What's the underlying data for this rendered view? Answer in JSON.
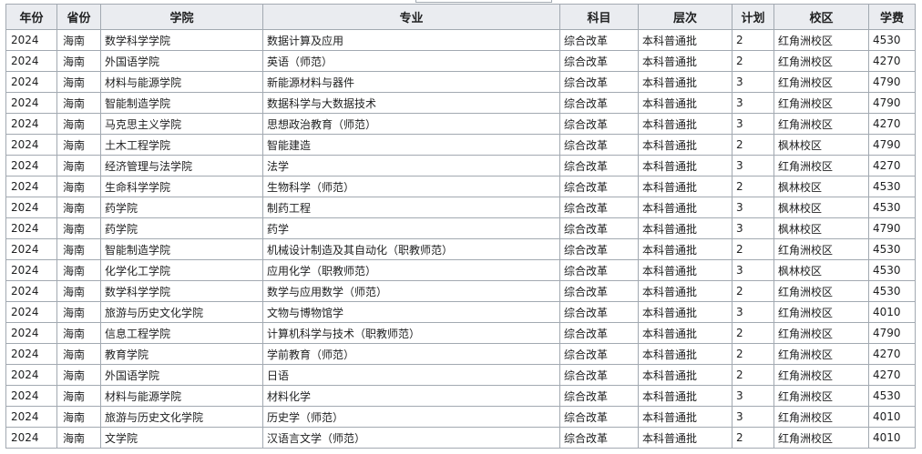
{
  "table": {
    "headers": [
      "年份",
      "省份",
      "学院",
      "专业",
      "科目",
      "层次",
      "计划",
      "校区",
      "学费"
    ],
    "rows": [
      [
        "2024",
        "海南",
        "数学科学学院",
        "数据计算及应用",
        "综合改革",
        "本科普通批",
        "2",
        "红角洲校区",
        "4530"
      ],
      [
        "2024",
        "海南",
        "外国语学院",
        "英语（师范）",
        "综合改革",
        "本科普通批",
        "2",
        "红角洲校区",
        "4270"
      ],
      [
        "2024",
        "海南",
        "材料与能源学院",
        "新能源材料与器件",
        "综合改革",
        "本科普通批",
        "3",
        "红角洲校区",
        "4790"
      ],
      [
        "2024",
        "海南",
        "智能制造学院",
        "数据科学与大数据技术",
        "综合改革",
        "本科普通批",
        "3",
        "红角洲校区",
        "4790"
      ],
      [
        "2024",
        "海南",
        "马克思主义学院",
        "思想政治教育（师范）",
        "综合改革",
        "本科普通批",
        "3",
        "红角洲校区",
        "4270"
      ],
      [
        "2024",
        "海南",
        "土木工程学院",
        "智能建造",
        "综合改革",
        "本科普通批",
        "2",
        "枫林校区",
        "4790"
      ],
      [
        "2024",
        "海南",
        "经济管理与法学院",
        "法学",
        "综合改革",
        "本科普通批",
        "3",
        "红角洲校区",
        "4270"
      ],
      [
        "2024",
        "海南",
        "生命科学学院",
        "生物科学（师范）",
        "综合改革",
        "本科普通批",
        "2",
        "枫林校区",
        "4530"
      ],
      [
        "2024",
        "海南",
        "药学院",
        "制药工程",
        "综合改革",
        "本科普通批",
        "3",
        "枫林校区",
        "4530"
      ],
      [
        "2024",
        "海南",
        "药学院",
        "药学",
        "综合改革",
        "本科普通批",
        "3",
        "枫林校区",
        "4790"
      ],
      [
        "2024",
        "海南",
        "智能制造学院",
        "机械设计制造及其自动化（职教师范）",
        "综合改革",
        "本科普通批",
        "2",
        "红角洲校区",
        "4530"
      ],
      [
        "2024",
        "海南",
        "化学化工学院",
        "应用化学（职教师范）",
        "综合改革",
        "本科普通批",
        "3",
        "枫林校区",
        "4530"
      ],
      [
        "2024",
        "海南",
        "数学科学学院",
        "数学与应用数学（师范）",
        "综合改革",
        "本科普通批",
        "2",
        "红角洲校区",
        "4530"
      ],
      [
        "2024",
        "海南",
        "旅游与历史文化学院",
        "文物与博物馆学",
        "综合改革",
        "本科普通批",
        "3",
        "红角洲校区",
        "4010"
      ],
      [
        "2024",
        "海南",
        "信息工程学院",
        "计算机科学与技术（职教师范）",
        "综合改革",
        "本科普通批",
        "2",
        "红角洲校区",
        "4790"
      ],
      [
        "2024",
        "海南",
        "教育学院",
        "学前教育（师范）",
        "综合改革",
        "本科普通批",
        "2",
        "红角洲校区",
        "4270"
      ],
      [
        "2024",
        "海南",
        "外国语学院",
        "日语",
        "综合改革",
        "本科普通批",
        "2",
        "红角洲校区",
        "4270"
      ],
      [
        "2024",
        "海南",
        "材料与能源学院",
        "材料化学",
        "综合改革",
        "本科普通批",
        "3",
        "红角洲校区",
        "4530"
      ],
      [
        "2024",
        "海南",
        "旅游与历史文化学院",
        "历史学（师范）",
        "综合改革",
        "本科普通批",
        "3",
        "红角洲校区",
        "4010"
      ],
      [
        "2024",
        "海南",
        "文学院",
        "汉语言文学（师范）",
        "综合改革",
        "本科普通批",
        "2",
        "红角洲校区",
        "4010"
      ]
    ]
  }
}
